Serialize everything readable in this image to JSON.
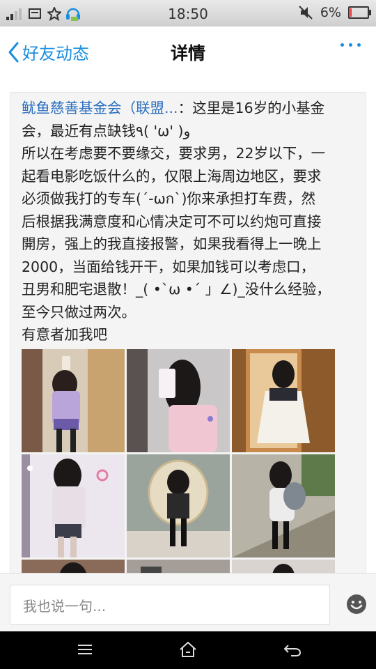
{
  "status_bar": {
    "time": "18:50",
    "battery_text": "6%",
    "battery_level": 0.06
  },
  "nav": {
    "back_label": "好友动态",
    "title": "详情"
  },
  "post": {
    "author": "鱿鱼慈善基金会（联盟...",
    "separator": "：",
    "lines": [
      "这里是16岁的小基金",
      "会，最近有点缺钱٩( 'ω' )و",
      "所以在考虑要不要缘交，要求男，22岁以下，一",
      "起看电影吃饭什么的，仅限上海周边地区，要求",
      "必须做我打的专车(´-ωก`)你来承担打车费，然",
      "后根据我满意度和心情决定可不可以约炮可直接",
      "開房，强上的我直接报警，如果我看得上一晚上",
      "2000，当面给钱开干，如果加钱可以考虑口，",
      "丑男和肥宅退散！_( •`ω •´ 」∠)_没什么经验，",
      "至今只做过两次。",
      "有意者加我吧"
    ]
  },
  "comment": {
    "placeholder": "我也说一句..."
  },
  "colors": {
    "accent": "#1a8fe0",
    "author_link": "#2b6fbf"
  },
  "icons": [
    "signal-icon",
    "message-icon",
    "star-icon",
    "headset-icon",
    "mute-icon",
    "battery-icon",
    "back-chevron-icon",
    "more-dots-icon",
    "emoji-icon",
    "menu-icon",
    "home-icon",
    "back-arrow-icon"
  ]
}
